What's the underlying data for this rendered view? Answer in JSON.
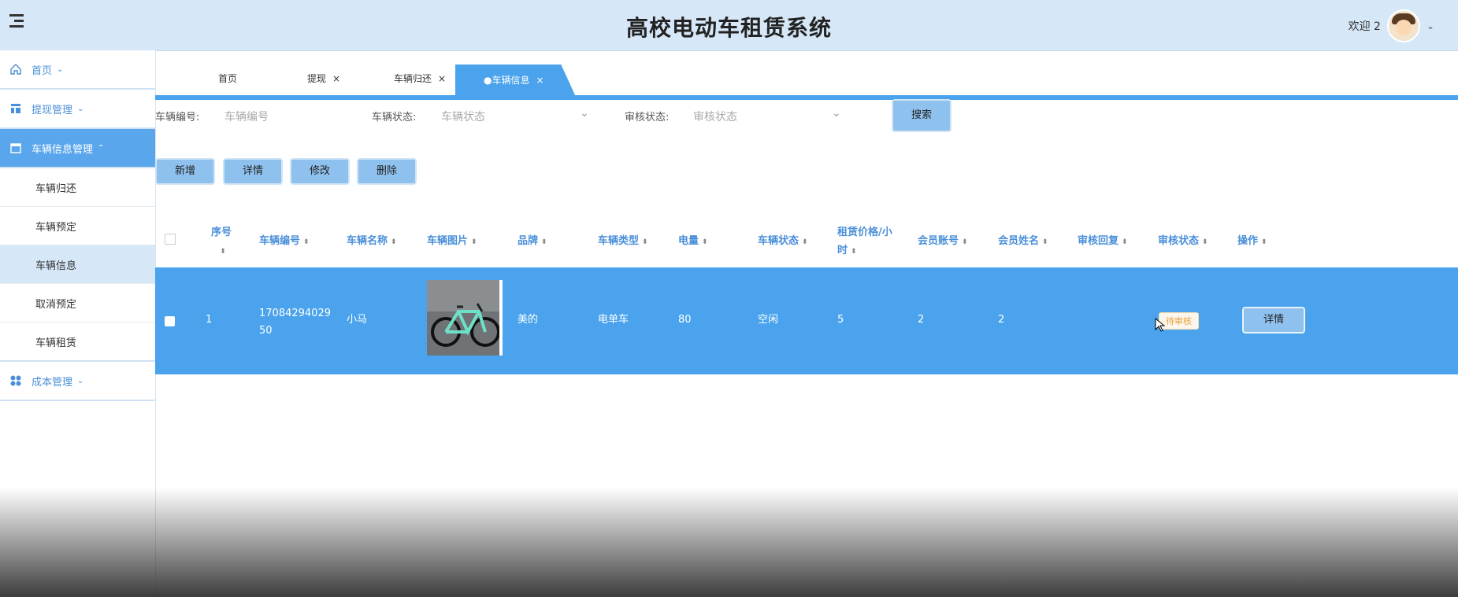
{
  "header": {
    "title": "高校电动车租赁系统",
    "welcome": "欢迎 2"
  },
  "sidebar": {
    "items": [
      {
        "label": "首页"
      },
      {
        "label": "提现管理"
      },
      {
        "label": "车辆信息管理"
      },
      {
        "label": "成本管理"
      }
    ],
    "submenu": [
      "车辆归还",
      "车辆预定",
      "车辆信息",
      "取消预定",
      "车辆租赁"
    ]
  },
  "tabs": [
    "首页",
    "提现",
    "车辆归还",
    "●车辆信息"
  ],
  "filters": {
    "vehicle_no_label": "车辆编号:",
    "vehicle_no_placeholder": "车辆编号",
    "vehicle_status_label": "车辆状态:",
    "vehicle_status_placeholder": "车辆状态",
    "audit_status_label": "审核状态:",
    "audit_status_placeholder": "审核状态",
    "search": "搜索"
  },
  "actions": {
    "add": "新增",
    "detail": "详情",
    "edit": "修改",
    "delete": "删除"
  },
  "table": {
    "columns": [
      "序号",
      "车辆编号",
      "车辆名称",
      "车辆图片",
      "品牌",
      "车辆类型",
      "电量",
      "车辆状态",
      "租赁价格/小时",
      "会员账号",
      "会员姓名",
      "审核回复",
      "审核状态",
      "操作"
    ],
    "rows": [
      {
        "index": "1",
        "vehicle_no": "1708429402950",
        "name": "小马",
        "brand": "美的",
        "type": "电单车",
        "battery": "80",
        "status": "空闲",
        "price": "5",
        "member_account": "2",
        "member_name": "2",
        "audit_reply": "",
        "audit_status": "待审核",
        "action": "详情"
      }
    ]
  },
  "colors": {
    "accent": "#4aa3ec",
    "header_bg": "#d6e8f8",
    "button": "#8fc1ee"
  }
}
